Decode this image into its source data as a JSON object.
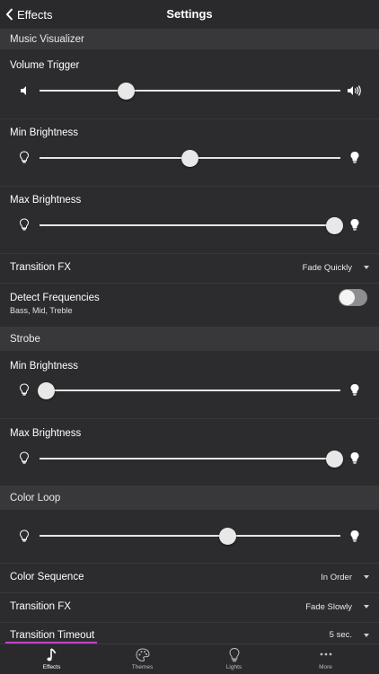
{
  "nav": {
    "back_label": "Effects",
    "title": "Settings"
  },
  "music_visualizer": {
    "header": "Music Visualizer",
    "volume_trigger": {
      "label": "Volume Trigger",
      "value": 0.28
    },
    "min_brightness": {
      "label": "Min Brightness",
      "value": 0.5
    },
    "max_brightness": {
      "label": "Max Brightness",
      "value": 1.0
    },
    "transition_fx": {
      "label": "Transition FX",
      "value": "Fade Quickly"
    },
    "detect_frequencies": {
      "label": "Detect Frequencies",
      "sublabel": "Bass, Mid, Treble",
      "enabled": false
    }
  },
  "strobe": {
    "header": "Strobe",
    "min_brightness": {
      "label": "Min Brightness",
      "value": 0.0
    },
    "max_brightness": {
      "label": "Max Brightness",
      "value": 1.0
    }
  },
  "color_loop": {
    "header": "Color Loop",
    "speed": {
      "value": 0.63
    },
    "color_sequence": {
      "label": "Color Sequence",
      "value": "In Order"
    },
    "transition_fx": {
      "label": "Transition FX",
      "value": "Fade Slowly"
    },
    "transition_timeout": {
      "label": "Transition Timeout",
      "value": "5 sec."
    }
  },
  "tabs": [
    {
      "label": "Effects",
      "icon": "music-note-icon",
      "active": true
    },
    {
      "label": "Themes",
      "icon": "palette-icon",
      "active": false
    },
    {
      "label": "Lights",
      "icon": "bulb-icon",
      "active": false
    },
    {
      "label": "More",
      "icon": "more-dots-icon",
      "active": false
    }
  ],
  "colors": {
    "background": "#2c2c2e",
    "section": "#38383b",
    "accent": "#c044c8"
  }
}
